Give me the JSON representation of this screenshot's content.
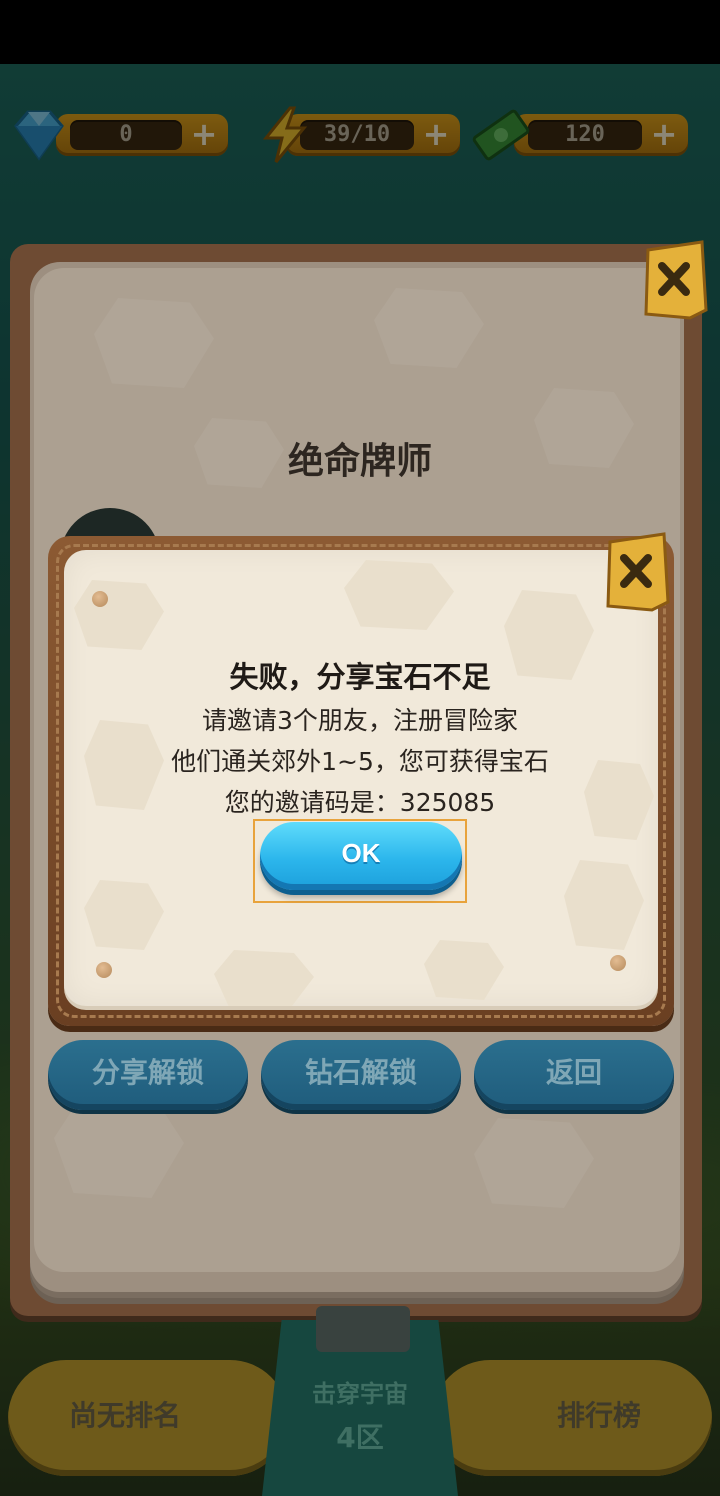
{
  "currency": {
    "gems": "0",
    "energy": "39/10",
    "cash": "120",
    "plus": "+"
  },
  "book": {
    "title": "绝命牌师",
    "buttons": {
      "share_unlock": "分享解锁",
      "diamond_unlock": "钻石解锁",
      "back": "返回"
    }
  },
  "bottom_bar": {
    "rank": "尚无排名",
    "zone_name": "击穿宇宙",
    "zone_id": "4区",
    "leaderboard": "排行榜"
  },
  "dialog": {
    "title": "失败，分享宝石不足",
    "line1": "请邀请3个朋友，注册冒险家",
    "line2": "他们通关郊外1~5，您可获得宝石",
    "line3": "您的邀请码是：325085",
    "ok_label": "OK"
  },
  "colors": {
    "ok_button": "#2cb6ec",
    "panel_paper": "#f1e9da",
    "frame_brown": "#7a4a28"
  }
}
